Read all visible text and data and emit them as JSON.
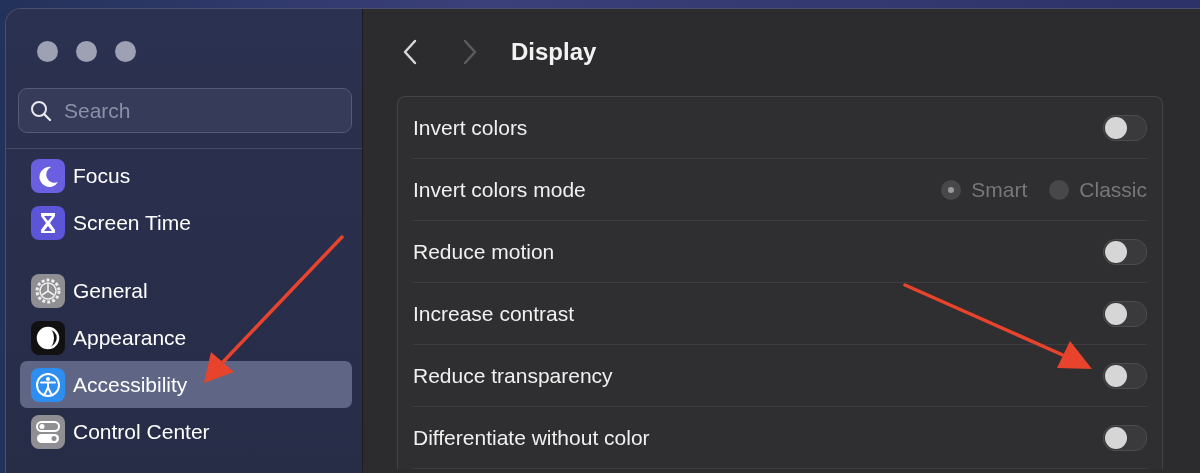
{
  "sidebar": {
    "search": {
      "placeholder": "Search"
    },
    "groups": [
      [
        {
          "label": "Focus",
          "kind": "focus",
          "selected": false
        },
        {
          "label": "Screen Time",
          "kind": "screentime",
          "selected": false
        }
      ],
      [
        {
          "label": "General",
          "kind": "general",
          "selected": false
        },
        {
          "label": "Appearance",
          "kind": "appearance",
          "selected": false
        },
        {
          "label": "Accessibility",
          "kind": "accessibility",
          "selected": true
        },
        {
          "label": "Control Center",
          "kind": "controlcenter",
          "selected": false
        }
      ]
    ]
  },
  "header": {
    "title": "Display",
    "back_disabled": false,
    "forward_disabled": true
  },
  "rows": [
    {
      "kind": "toggle",
      "label": "Invert colors",
      "on": false
    },
    {
      "kind": "radio",
      "label": "Invert colors mode",
      "disabled": true,
      "options": [
        {
          "label": "Smart",
          "selected": true
        },
        {
          "label": "Classic",
          "selected": false
        }
      ]
    },
    {
      "kind": "toggle",
      "label": "Reduce motion",
      "on": false
    },
    {
      "kind": "toggle",
      "label": "Increase contrast",
      "on": false
    },
    {
      "kind": "toggle",
      "label": "Reduce transparency",
      "on": false
    },
    {
      "kind": "toggle",
      "label": "Differentiate without color",
      "on": false
    }
  ]
}
